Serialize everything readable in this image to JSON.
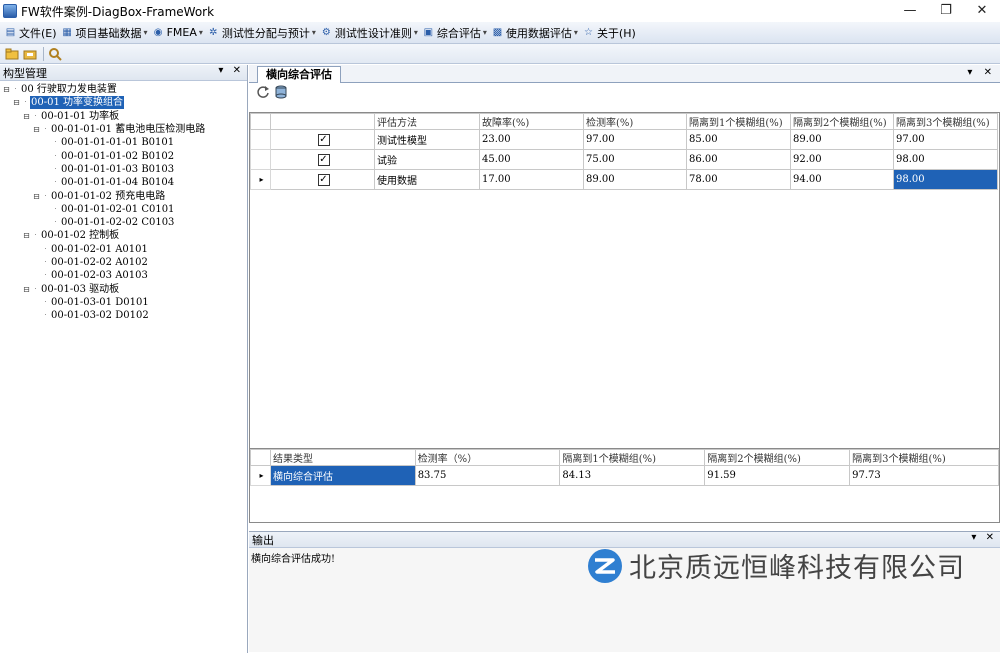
{
  "window": {
    "title": "FW软件案例-DiagBox-FrameWork",
    "minimize": "—",
    "maximize": "❐",
    "close": "✕"
  },
  "menu": [
    {
      "label": "文件(E)",
      "icon": "file-icon",
      "glyph": "▤",
      "arrow": ""
    },
    {
      "label": "项目基础数据",
      "icon": "document-icon",
      "glyph": "▦",
      "arrow": "▾"
    },
    {
      "label": "FMEA",
      "icon": "globe-icon",
      "glyph": "◉",
      "arrow": "▾"
    },
    {
      "label": "测试性分配与预计",
      "icon": "gear-icon",
      "glyph": "✲",
      "arrow": "▾"
    },
    {
      "label": "测试性设计准则",
      "icon": "settings-icon",
      "glyph": "⚙",
      "arrow": "▾"
    },
    {
      "label": "综合评估",
      "icon": "grid-icon",
      "glyph": "▣",
      "arrow": "▾"
    },
    {
      "label": "使用数据评估",
      "icon": "data-icon",
      "glyph": "▩",
      "arrow": "▾"
    },
    {
      "label": "关于(H)",
      "icon": "star-icon",
      "glyph": "☆",
      "arrow": ""
    }
  ],
  "left_panel": {
    "title": "构型管理",
    "controls": "▾ ✕"
  },
  "tree": [
    {
      "label": "00 行驶取力发电装置",
      "level": 0,
      "toggle": "⊟",
      "selected": false
    },
    {
      "label": "00-01 功率变换组合",
      "level": 1,
      "toggle": "⊟",
      "selected": true
    },
    {
      "label": "00-01-01 功率板",
      "level": 2,
      "toggle": "⊟",
      "selected": false
    },
    {
      "label": "00-01-01-01 蓄电池电压检测电路",
      "level": 3,
      "toggle": "⊟",
      "selected": false
    },
    {
      "label": "00-01-01-01-01 B0101",
      "level": 4,
      "toggle": "",
      "selected": false
    },
    {
      "label": "00-01-01-01-02 B0102",
      "level": 4,
      "toggle": "",
      "selected": false
    },
    {
      "label": "00-01-01-01-03 B0103",
      "level": 4,
      "toggle": "",
      "selected": false
    },
    {
      "label": "00-01-01-01-04 B0104",
      "level": 4,
      "toggle": "",
      "selected": false
    },
    {
      "label": "00-01-01-02 预充电电路",
      "level": 3,
      "toggle": "⊟",
      "selected": false
    },
    {
      "label": "00-01-01-02-01 C0101",
      "level": 4,
      "toggle": "",
      "selected": false
    },
    {
      "label": "00-01-01-02-02 C0103",
      "level": 4,
      "toggle": "",
      "selected": false
    },
    {
      "label": "00-01-02 控制板",
      "level": 2,
      "toggle": "⊟",
      "selected": false
    },
    {
      "label": "00-01-02-01 A0101",
      "level": 3,
      "toggle": "",
      "selected": false
    },
    {
      "label": "00-01-02-02 A0102",
      "level": 3,
      "toggle": "",
      "selected": false
    },
    {
      "label": "00-01-02-03 A0103",
      "level": 3,
      "toggle": "",
      "selected": false
    },
    {
      "label": "00-01-03 驱动板",
      "level": 2,
      "toggle": "⊟",
      "selected": false
    },
    {
      "label": "00-01-03-01 D0101",
      "level": 3,
      "toggle": "",
      "selected": false
    },
    {
      "label": "00-01-03-02 D0102",
      "level": 3,
      "toggle": "",
      "selected": false
    }
  ],
  "main_tab": {
    "label": "横向综合评估",
    "controls": "▾ ✕"
  },
  "eval_grid": {
    "headers": [
      "评估方法",
      "故障率(%)",
      "检测率(%)",
      "隔离到1个模糊组(%)",
      "隔离到2个模糊组(%)",
      "隔离到3个模糊组(%)"
    ],
    "rows": [
      {
        "checked": "✓",
        "indicator": "",
        "cells": [
          "测试性模型",
          "23.00",
          "97.00",
          "85.00",
          "89.00",
          "97.00"
        ]
      },
      {
        "checked": "✓",
        "indicator": "",
        "cells": [
          "试验",
          "45.00",
          "75.00",
          "86.00",
          "92.00",
          "98.00"
        ]
      },
      {
        "checked": "✓",
        "indicator": "▸",
        "cells": [
          "使用数据",
          "17.00",
          "89.00",
          "78.00",
          "94.00",
          "98.00"
        ]
      }
    ]
  },
  "result_grid": {
    "headers": [
      "结果类型",
      "检测率（%）",
      "隔离到1个模糊组(%)",
      "隔离到2个模糊组(%)",
      "隔离到3个模糊组(%)"
    ],
    "rows": [
      {
        "indicator": "▸",
        "cells": [
          "横向综合评估",
          "83.75",
          "84.13",
          "91.59",
          "97.73"
        ]
      }
    ]
  },
  "output": {
    "title": "输出",
    "controls": "▾ ✕",
    "message": "横向综合评估成功!"
  },
  "watermark": {
    "text": "北京质远恒峰科技有限公司"
  },
  "colors": {
    "selection": "#1f62b6",
    "menu_bg": "#dbe4f1",
    "logo": "#2f7fd1"
  }
}
